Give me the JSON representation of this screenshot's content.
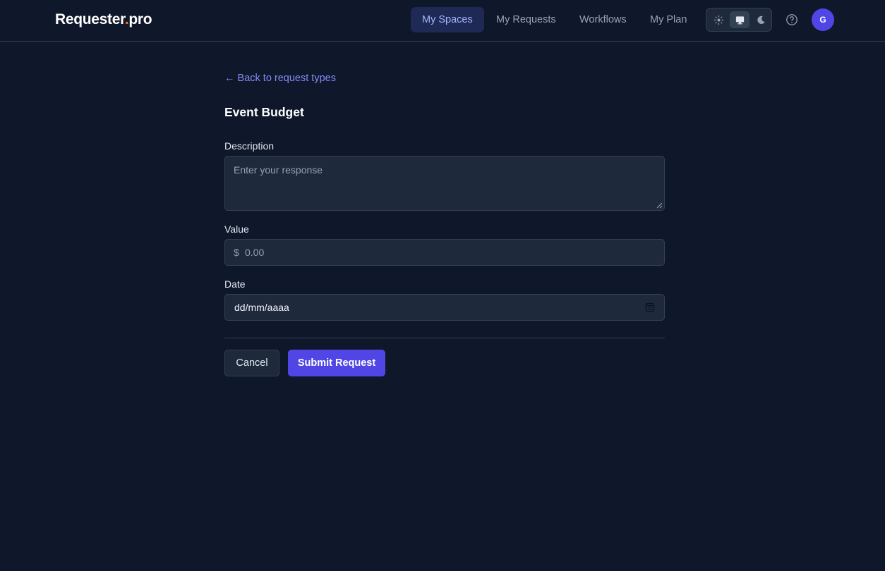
{
  "header": {
    "logo_main": "Requester",
    "logo_dot": ".",
    "logo_tld": "pro",
    "nav": [
      {
        "label": "My Spaces",
        "active": true
      },
      {
        "label": "My Requests",
        "active": false
      },
      {
        "label": "Workflows",
        "active": false
      },
      {
        "label": "My Plan",
        "active": false
      }
    ],
    "theme_options": [
      {
        "icon": "sun-icon",
        "active": false
      },
      {
        "icon": "monitor-icon",
        "active": true
      },
      {
        "icon": "moon-icon",
        "active": false
      }
    ],
    "help_icon": "help-circle-icon",
    "avatar_initial": "G"
  },
  "form": {
    "back_link": "← Back to request types",
    "title": "Event Budget",
    "description": {
      "label": "Description",
      "placeholder": "Enter your response",
      "value": ""
    },
    "value": {
      "label": "Value",
      "currency_symbol": "$",
      "placeholder": "0.00",
      "value": ""
    },
    "date": {
      "label": "Date",
      "display_value": "dd/mm/aaaa",
      "icon": "calendar-icon"
    },
    "cancel_label": "Cancel",
    "submit_label": "Submit Request"
  },
  "colors": {
    "background": "#0f172a",
    "input_background": "#1e293b",
    "border": "#334155",
    "accent": "#4f46e5",
    "link": "#818cf8",
    "logo_dot": "#f97316"
  }
}
